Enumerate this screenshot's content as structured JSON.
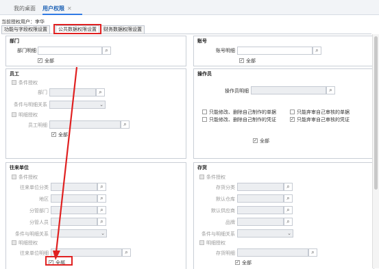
{
  "tabs": {
    "t1": "我的桌面",
    "t2": "用户权限",
    "close": "✕"
  },
  "current_user": {
    "label": "当前授权用户：",
    "name": "李华"
  },
  "subtabs": {
    "s1": "功能与字段权限设置",
    "s2": "公共数据权限设置",
    "s3": "财务数据权限设置"
  },
  "dept": {
    "title": "部门",
    "detail_label": "部门明细",
    "all": "全部"
  },
  "account": {
    "title": "账号",
    "detail_label": "账号明细",
    "all": "全部"
  },
  "employee": {
    "title": "员工",
    "cond_auth": "条件授权",
    "dept": "部门",
    "cond_rel": "条件与明细关系",
    "detail_auth": "明细授权",
    "emp_detail": "员工明细",
    "all": "全部"
  },
  "operator": {
    "title": "操作员",
    "detail_label": "操作员明细",
    "opt1": "只能修改、删除自己制作的单据",
    "opt2": "只能修改、删除自己制作的凭证",
    "opt3": "只能弃审自己审核的单据",
    "opt4": "只能弃审自己审核的凭证",
    "all": "全部"
  },
  "partner": {
    "title": "往来单位",
    "cond_auth": "条件授权",
    "cls": "往来单位分类",
    "region": "地区",
    "dept": "分管部门",
    "person": "分管人员",
    "cond_rel": "条件与明细关系",
    "detail_auth": "明细授权",
    "detail": "往来单位明细",
    "all": "全部"
  },
  "stock": {
    "title": "存货",
    "cond_auth": "条件授权",
    "cls": "存货分类",
    "wh": "默认仓库",
    "supplier": "默认供应商",
    "brand": "品牌",
    "cond_rel": "条件与明细关系",
    "detail_auth": "明细授权",
    "detail": "存货明细",
    "all": "全部"
  },
  "icons": {
    "search": "⌕",
    "chevron": "⌄",
    "check": "✓"
  },
  "colors": {
    "annotation": "#e02020",
    "active_tab": "#1a5fb4"
  }
}
